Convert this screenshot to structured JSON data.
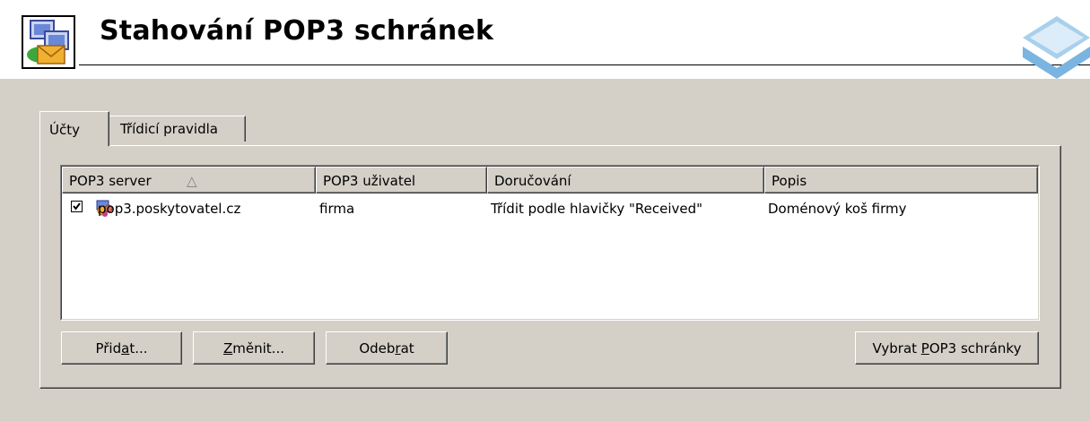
{
  "header": {
    "title": "Stahování POP3 schránek"
  },
  "tabs": [
    {
      "label": "Účty",
      "active": true
    },
    {
      "label": "Třídicí pravidla",
      "active": false
    }
  ],
  "list": {
    "columns": [
      {
        "label": "POP3 server",
        "sorted": "ascending"
      },
      {
        "label": "POP3 uživatel"
      },
      {
        "label": "Doručování"
      },
      {
        "label": "Popis"
      }
    ],
    "sort_indicator": "△",
    "rows": [
      {
        "checked": true,
        "server": "pop3.poskytovatel.cz",
        "user": "firma",
        "delivery": "Třídit podle hlavičky \"Received\"",
        "description": "Doménový koš firmy"
      }
    ]
  },
  "buttons": {
    "add": {
      "pre": "Přid",
      "mnemonic": "a",
      "post": "t..."
    },
    "edit": {
      "pre": "",
      "mnemonic": "Z",
      "post": "měnit..."
    },
    "remove": {
      "pre": "Odeb",
      "mnemonic": "r",
      "post": "at"
    },
    "select": {
      "pre": "Vybrat ",
      "mnemonic": "P",
      "post": "OP3 schránky"
    }
  },
  "icons": {
    "app": "pop3-mail-computer-icon",
    "server": "mailbox-users-icon",
    "logo": "blue-layers-logo"
  },
  "colors": {
    "panel": "#d4d0c8",
    "accent": "#4a90c8"
  }
}
